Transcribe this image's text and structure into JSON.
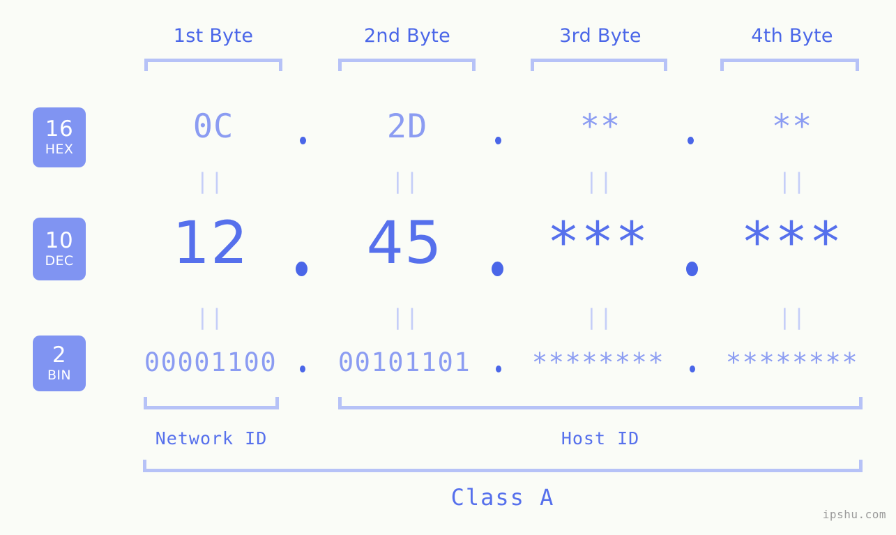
{
  "background_color": "#fafcf7",
  "accent_color": "#5670ec",
  "bracket_color": "#b6c2f7",
  "badge_color": "#8094f2",
  "muted_color": "#8b9cf2",
  "header": {
    "bytes": [
      {
        "label": "1st Byte"
      },
      {
        "label": "2nd Byte"
      },
      {
        "label": "3rd Byte"
      },
      {
        "label": "4th Byte"
      }
    ]
  },
  "rows": [
    {
      "base_number": "16",
      "base_name": "HEX",
      "values": [
        "0C",
        "2D",
        "**",
        "**"
      ],
      "separator": "."
    },
    {
      "base_number": "10",
      "base_name": "DEC",
      "values": [
        "12",
        "45",
        "***",
        "***"
      ],
      "separator": "."
    },
    {
      "base_number": "2",
      "base_name": "BIN",
      "values": [
        "00001100",
        "00101101",
        "********",
        "********"
      ],
      "separator": "."
    }
  ],
  "equals_glyph": "||",
  "partition": {
    "network_id_label": "Network ID",
    "host_id_label": "Host ID"
  },
  "class_label": "Class A",
  "watermark": "ipshu.com"
}
